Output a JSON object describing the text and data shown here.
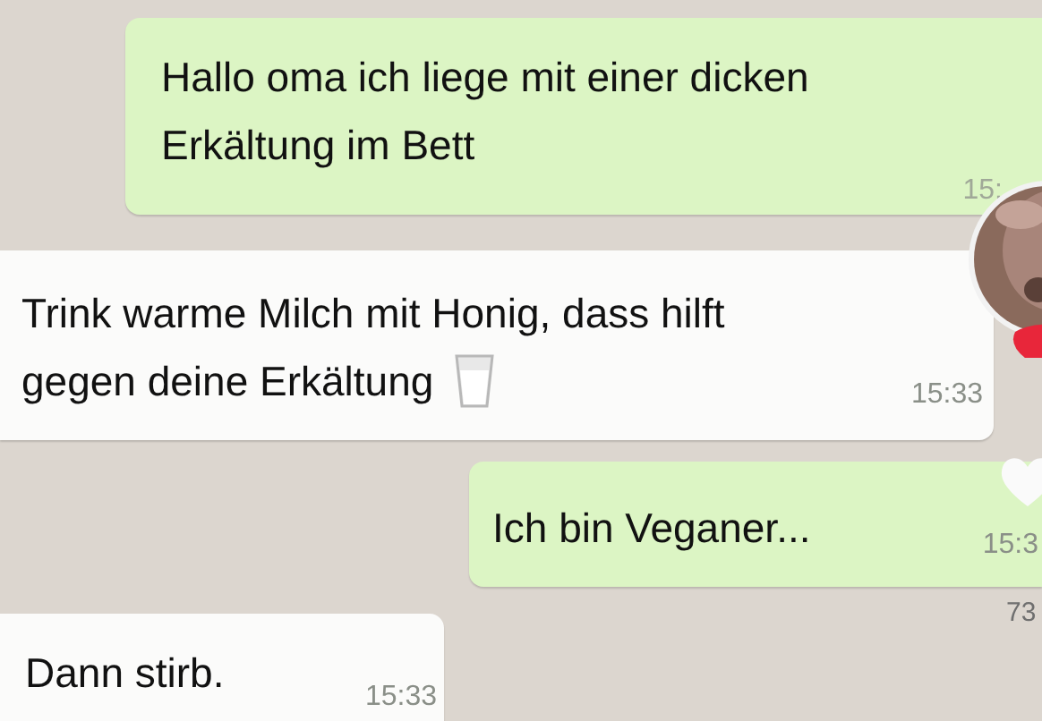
{
  "messages": [
    {
      "kind": "outgoing",
      "lines": [
        "Hallo oma ich liege mit einer dicken",
        "Erkältung im Bett"
      ],
      "time": "15:",
      "trailing_icon": false
    },
    {
      "kind": "incoming",
      "lines": [
        "Trink warme Milch mit Honig, dass hilft",
        "gegen deine Erkältung"
      ],
      "time": "15:33",
      "trailing_icon": true
    },
    {
      "kind": "outgoing",
      "lines": [
        "Ich bin Veganer..."
      ],
      "time": "15:3",
      "trailing_icon": false
    },
    {
      "kind": "incoming",
      "lines": [
        "Dann stirb."
      ],
      "time": "15:33",
      "trailing_icon": false
    }
  ],
  "overlay": {
    "count": "73"
  }
}
